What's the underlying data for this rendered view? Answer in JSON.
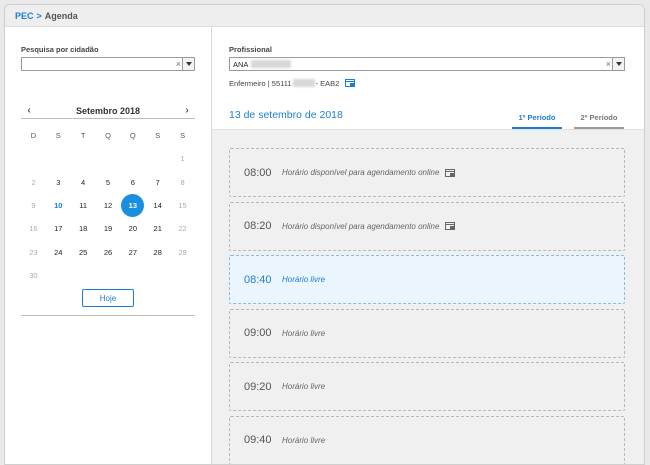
{
  "breadcrumb": {
    "root": "PEC",
    "separator": ">",
    "current": "Agenda"
  },
  "patient_search": {
    "label": "Pesquisa por cidadão",
    "value": "",
    "clear_glyph": "×"
  },
  "calendar": {
    "month_label": "Setembro 2018",
    "prev_glyph": "‹",
    "next_glyph": "›",
    "weekdays": [
      "D",
      "S",
      "T",
      "Q",
      "Q",
      "S",
      "S"
    ],
    "weeks": [
      [
        "",
        "",
        "",
        "",
        "",
        "",
        "1"
      ],
      [
        "2",
        "3",
        "4",
        "5",
        "6",
        "7",
        "8"
      ],
      [
        "9",
        "10",
        "11",
        "12",
        "13",
        "14",
        "15"
      ],
      [
        "16",
        "17",
        "18",
        "19",
        "20",
        "21",
        "22"
      ],
      [
        "23",
        "24",
        "25",
        "26",
        "27",
        "28",
        "29"
      ],
      [
        "30",
        "",
        "",
        "",
        "",
        "",
        ""
      ]
    ],
    "today": "10",
    "selected": "13",
    "today_button": "Hoje"
  },
  "professional": {
    "label": "Profissional",
    "value": "ANA",
    "clear_glyph": "×",
    "role": "Enfermeiro | 55111",
    "team": "- EAB2"
  },
  "schedule": {
    "date_title": "13 de setembro de 2018",
    "tabs": [
      "1º Período",
      "2º Período"
    ],
    "active_tab": 0,
    "slots": [
      {
        "time": "08:00",
        "desc": "Horário disponível para agendamento online",
        "online_icon": true,
        "state": "online"
      },
      {
        "time": "08:20",
        "desc": "Horário disponível para agendamento online",
        "online_icon": true,
        "state": "online"
      },
      {
        "time": "08:40",
        "desc": "Horário livre",
        "online_icon": false,
        "state": "highlight"
      },
      {
        "time": "09:00",
        "desc": "Horário livre",
        "online_icon": false,
        "state": "free"
      },
      {
        "time": "09:20",
        "desc": "Horário livre",
        "online_icon": false,
        "state": "free"
      },
      {
        "time": "09:40",
        "desc": "Horário livre",
        "online_icon": false,
        "state": "free"
      }
    ]
  },
  "colors": {
    "accent": "#1a7fd4",
    "selected_day": "#1a8fe0",
    "highlight_slot": "#eaf5fd"
  },
  "icons": {
    "online": "online-schedule-icon",
    "dropdown": "chevron-down-icon",
    "clear": "clear-icon"
  }
}
